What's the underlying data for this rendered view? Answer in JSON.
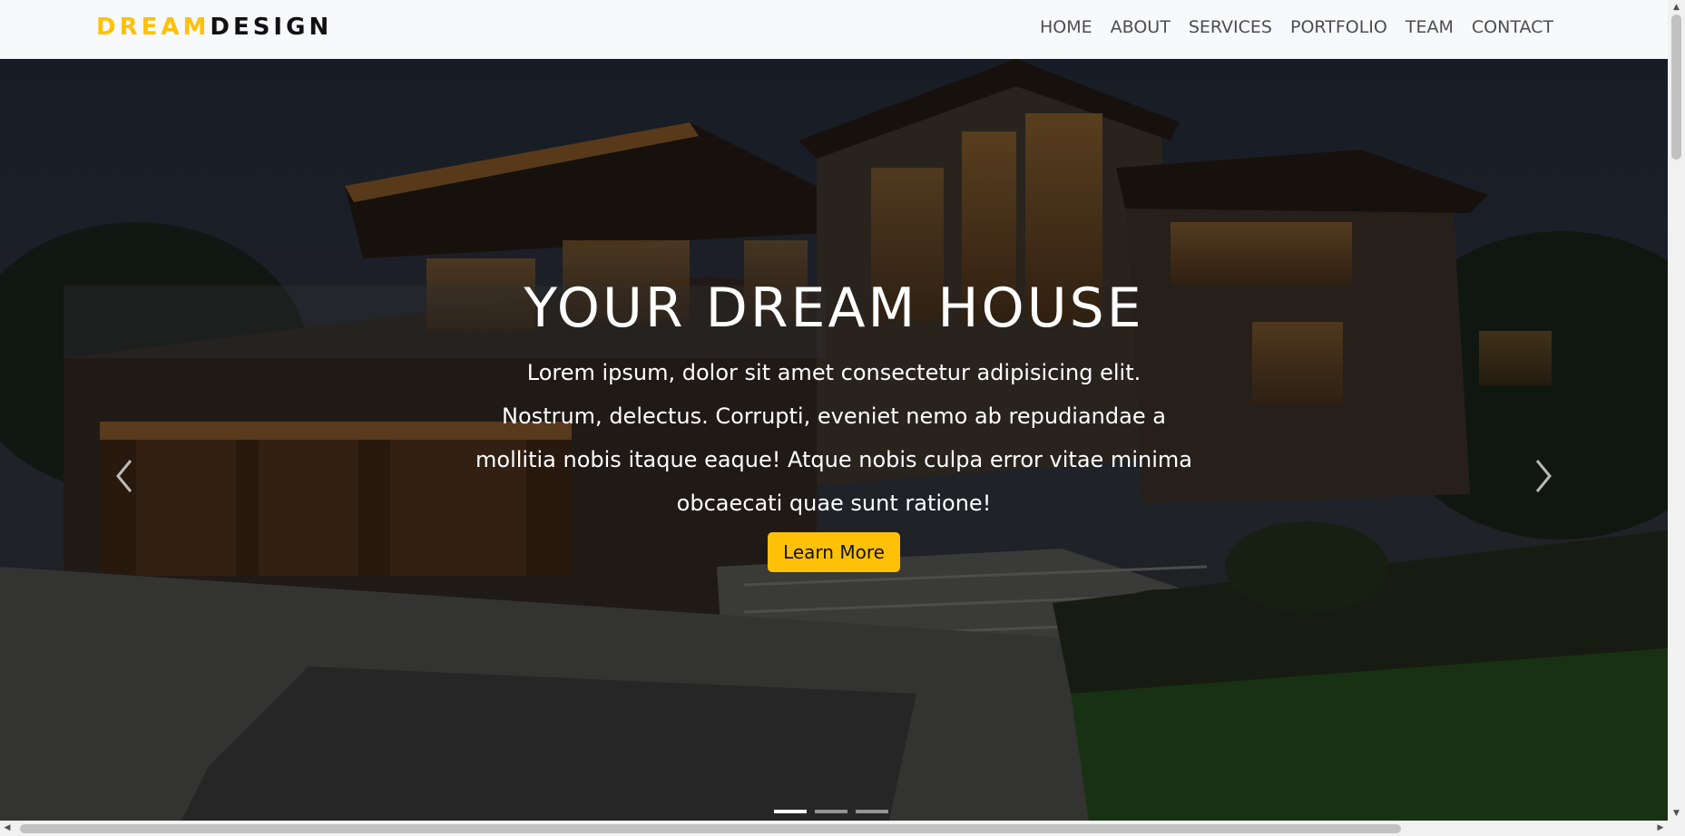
{
  "navbar": {
    "brand_accent": "DREAM",
    "brand_main": "DESIGN",
    "links": [
      {
        "label": "HOME"
      },
      {
        "label": "ABOUT"
      },
      {
        "label": "SERVICES"
      },
      {
        "label": "PORTFOLIO"
      },
      {
        "label": "TEAM"
      },
      {
        "label": "CONTACT"
      }
    ]
  },
  "hero": {
    "title": "YOUR DREAM HOUSE",
    "text": "Lorem ipsum, dolor sit amet consectetur adipisicing elit. Nostrum, delectus. Corrupti, eveniet nemo ab repudiandae a mollitia nobis itaque eaque! Atque nobis culpa error vitae minima obcaecati quae sunt ratione!",
    "button_label": "Learn More",
    "prev_icon": "chevron-left-icon",
    "next_icon": "chevron-right-icon",
    "slide_count": 3,
    "active_slide": 1
  },
  "colors": {
    "accent": "#ffc107",
    "navbar_bg": "#f8f9fa",
    "nav_text": "#4d4d4d"
  }
}
